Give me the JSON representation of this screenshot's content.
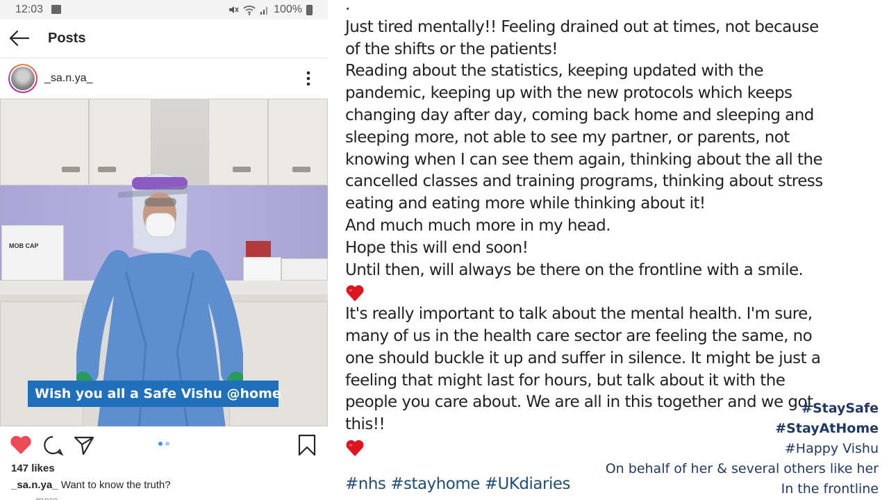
{
  "status_bar": {
    "time": "12:03",
    "battery": "100%"
  },
  "app_bar": {
    "title": "Posts"
  },
  "post": {
    "username": "_sa.n.ya_",
    "image_caption": "Wish you all a Safe Vishu @home",
    "image_box_label": "MOB CAP",
    "likes": "147 likes",
    "caption_username": "_sa.n.ya_",
    "caption_text": " Want to know the truth?",
    "more_label": "... more"
  },
  "body_text": {
    "top_mark": ".",
    "lines": [
      "Just tired mentally!! Feeling drained out at times, not because",
      "of the shifts or the patients!",
      "Reading about the statistics, keeping updated with the",
      "pandemic, keeping up with the new protocols which keeps",
      "changing day after day, coming back home and sleeping and",
      "sleeping more, not able to see my partner, or parents, not",
      "knowing when I can see them again, thinking about the all the",
      "cancelled classes and training programs, thinking about stress",
      "eating and eating more while thinking about it!",
      "And much much more in my head.",
      "Hope this will end soon!",
      "Until then, will always be there on the frontline with a smile."
    ],
    "lines2": [
      "It's really important to talk about the mental health. I'm sure,",
      "many of us in the health care sector are feeling the same, no",
      "one should buckle it up and suffer in silence. It might be just a",
      "feeling that might last for hours, but talk about it with the",
      "people you care about. We are all in this together and we got",
      "this!!"
    ],
    "hashtags": "#nhs #stayhome #UKdiaries"
  },
  "overlay_text": {
    "line1": "#StaySafe",
    "line2": "#StayAtHome",
    "line3": "#Happy Vishu",
    "line4": "On behalf of her & several others like her",
    "line5": "In the frontline"
  },
  "colors": {
    "caption_bg": "#1f6fba",
    "heart_red": "#ed4956",
    "emoji_heart": "#e0141e",
    "overlay_text": "#1f3864",
    "hashtag_text": "#1f4e79"
  }
}
